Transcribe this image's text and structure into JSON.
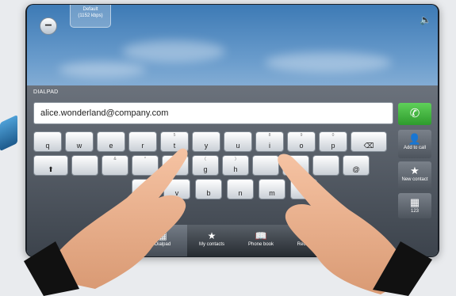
{
  "profile": {
    "name": "Default",
    "bandwidth": "(1152 kbps)"
  },
  "dialpad": {
    "label": "DIALPAD",
    "entry_value": "alice.wonderland@company.com"
  },
  "side": {
    "add_to_call": "Add to call",
    "new_contact": "New contact",
    "keypad": "123"
  },
  "keyboard": {
    "row1": [
      {
        "k": "q",
        "s": ""
      },
      {
        "k": "w",
        "s": ""
      },
      {
        "k": "e",
        "s": ""
      },
      {
        "k": "r",
        "s": ""
      },
      {
        "k": "t",
        "s": "5"
      },
      {
        "k": "y",
        "s": ""
      },
      {
        "k": "u",
        "s": ""
      },
      {
        "k": "i",
        "s": "8"
      },
      {
        "k": "o",
        "s": "9"
      },
      {
        "k": "p",
        "s": "0"
      }
    ],
    "row2": [
      {
        "k": "",
        "s": ""
      },
      {
        "k": "",
        "s": "&"
      },
      {
        "k": "",
        "s": "*"
      },
      {
        "k": "f",
        "s": "%"
      },
      {
        "k": "g",
        "s": "("
      },
      {
        "k": "h",
        "s": ")"
      },
      {
        "k": "",
        "s": ""
      },
      {
        "k": "",
        "s": ""
      },
      {
        "k": "",
        "s": ""
      },
      {
        "k": "@",
        "s": ""
      }
    ],
    "row3": [
      {
        "k": "c",
        "s": ""
      },
      {
        "k": "v",
        "s": ""
      },
      {
        "k": "b",
        "s": ""
      },
      {
        "k": "n",
        "s": ""
      },
      {
        "k": "m",
        "s": ""
      },
      {
        "k": ".",
        "s": ""
      }
    ]
  },
  "tabs": [
    {
      "label": "Dialpad",
      "icon": "grid-icon"
    },
    {
      "label": "My contacts",
      "icon": "star-icon"
    },
    {
      "label": "Phone book",
      "icon": "book-icon"
    },
    {
      "label": "Recent calls",
      "icon": "clock-icon"
    }
  ]
}
